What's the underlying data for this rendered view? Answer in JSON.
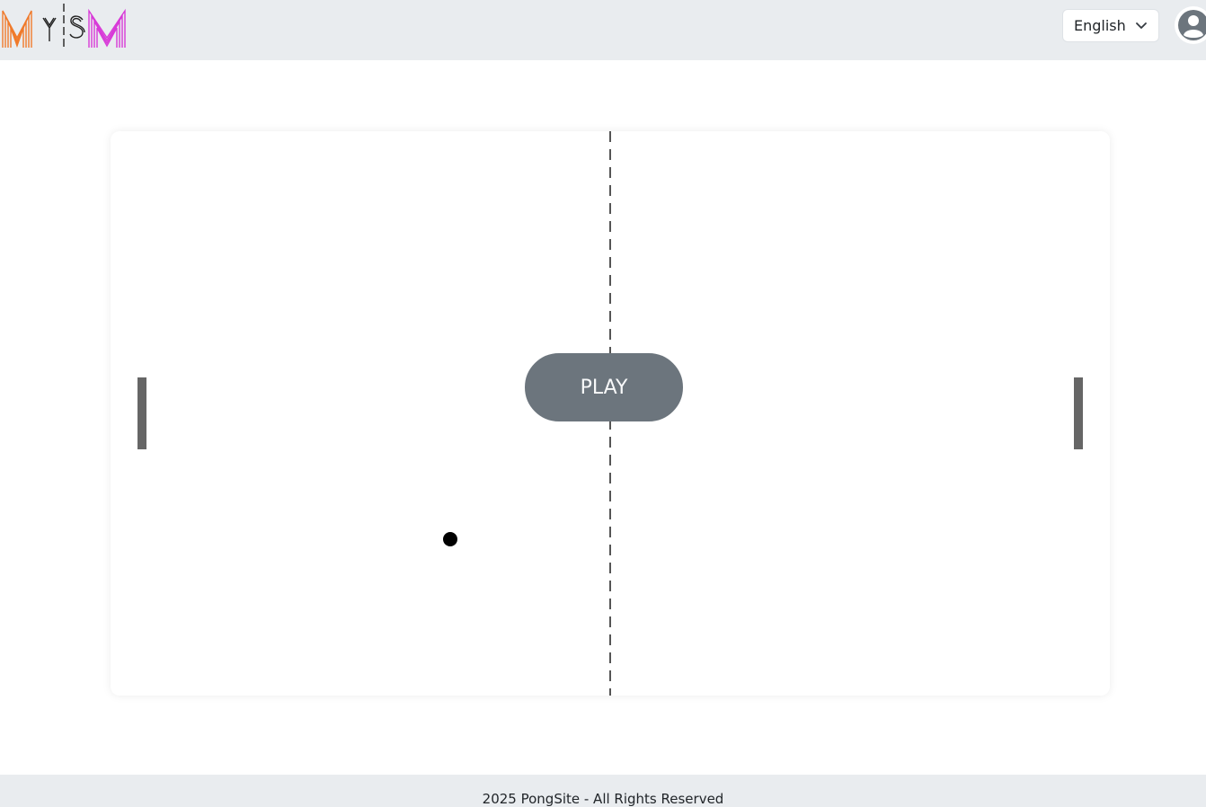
{
  "navbar": {
    "logo_alt": "MYSM",
    "language": {
      "selected": "English"
    }
  },
  "game": {
    "play_label": "PLAY"
  },
  "footer": {
    "text": "2025 PongSite - All Rights Reserved"
  },
  "colors": {
    "navbar_bg": "#e9ecef",
    "play_button": "#6c757d",
    "paddle": "#666666",
    "logo_orange": "#f07a2b",
    "logo_magenta": "#d83ad8"
  }
}
